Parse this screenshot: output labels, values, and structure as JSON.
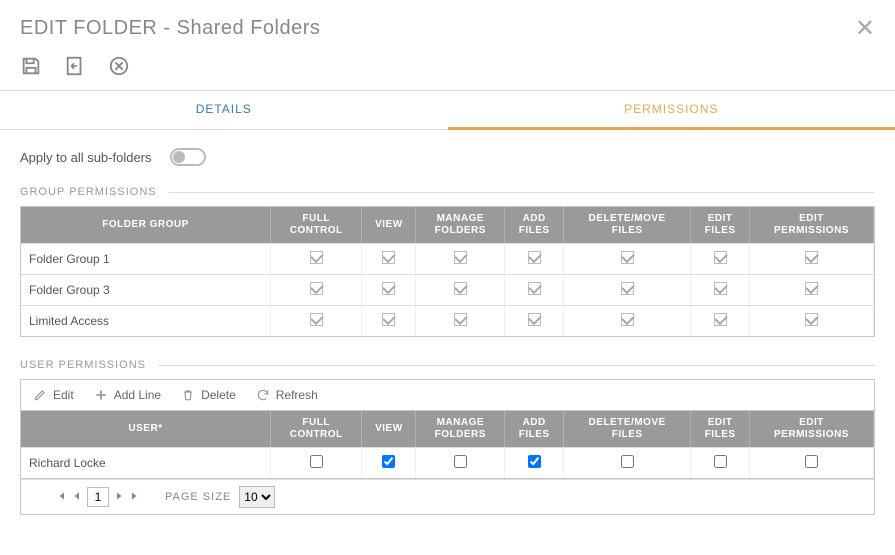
{
  "header": {
    "title": "EDIT FOLDER - Shared Folders"
  },
  "tabs": {
    "details": "DETAILS",
    "permissions": "PERMISSIONS"
  },
  "apply_sub": {
    "label": "Apply to all sub-folders",
    "on": false
  },
  "group_permissions": {
    "heading": "GROUP PERMISSIONS",
    "columns": [
      "FOLDER GROUP",
      "FULL CONTROL",
      "VIEW",
      "MANAGE FOLDERS",
      "ADD FILES",
      "DELETE/MOVE FILES",
      "EDIT FILES",
      "EDIT PERMISSIONS"
    ],
    "rows": [
      {
        "name": "Folder Group 1",
        "perms": [
          true,
          true,
          true,
          true,
          true,
          true,
          true
        ]
      },
      {
        "name": "Folder Group 3",
        "perms": [
          true,
          true,
          true,
          true,
          true,
          true,
          true
        ]
      },
      {
        "name": "Limited Access",
        "perms": [
          true,
          true,
          true,
          true,
          true,
          true,
          true
        ]
      }
    ]
  },
  "user_permissions": {
    "heading": "USER PERMISSIONS",
    "toolbar": {
      "edit": "Edit",
      "add_line": "Add Line",
      "delete": "Delete",
      "refresh": "Refresh"
    },
    "columns": [
      "USER*",
      "FULL CONTROL",
      "VIEW",
      "MANAGE FOLDERS",
      "ADD FILES",
      "DELETE/MOVE FILES",
      "EDIT FILES",
      "EDIT PERMISSIONS"
    ],
    "rows": [
      {
        "name": "Richard Locke",
        "perms": [
          false,
          true,
          false,
          true,
          false,
          false,
          false
        ]
      }
    ],
    "pager": {
      "page": "1",
      "page_size_label": "PAGE SIZE",
      "page_size": "10"
    }
  }
}
